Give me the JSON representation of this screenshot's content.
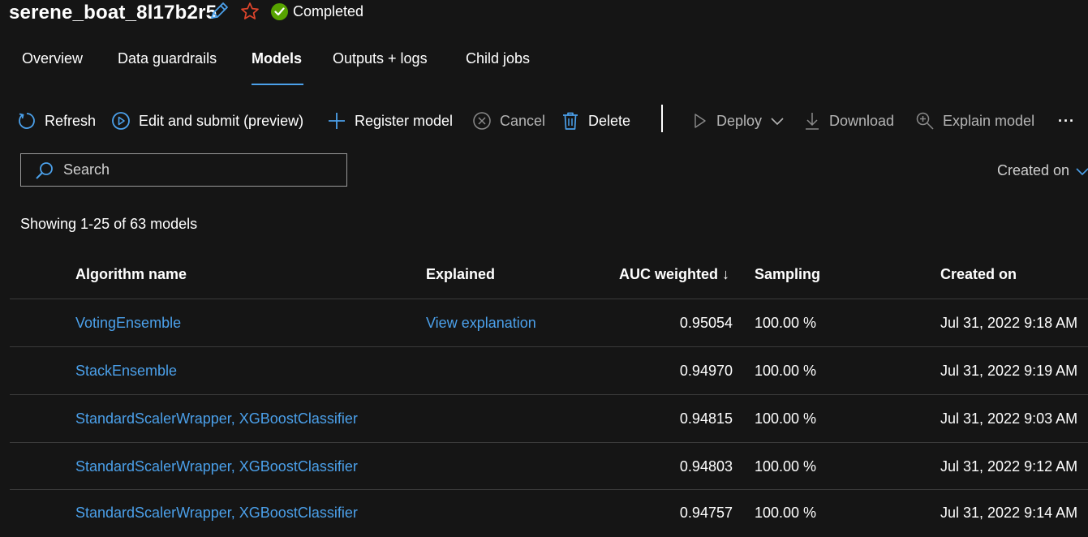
{
  "header": {
    "title": "serene_boat_8l17b2r5",
    "status": "Completed",
    "edit_icon": "pencil-icon",
    "favorite_icon": "star-icon",
    "status_icon": "check-circle-icon",
    "status_color": "#57a300"
  },
  "tabs": [
    {
      "label": "Overview"
    },
    {
      "label": "Data guardrails"
    },
    {
      "label": "Models",
      "active": true
    },
    {
      "label": "Outputs + logs"
    },
    {
      "label": "Child jobs"
    }
  ],
  "toolbar": {
    "refresh": "Refresh",
    "edit_submit": "Edit and submit (preview)",
    "register": "Register model",
    "cancel": "Cancel",
    "delete": "Delete",
    "deploy": "Deploy",
    "download": "Download",
    "explain": "Explain model",
    "more": "···"
  },
  "search": {
    "placeholder": "Search"
  },
  "sort": {
    "label": "Created on"
  },
  "summary": "Showing 1-25 of 63 models",
  "table": {
    "columns": {
      "algorithm": "Algorithm name",
      "explained": "Explained",
      "auc": "AUC weighted ↓",
      "sampling": "Sampling",
      "created": "Created on"
    },
    "rows": [
      {
        "algorithm": "VotingEnsemble",
        "explained": "View explanation",
        "auc": "0.95054",
        "sampling": "100.00 %",
        "created": "Jul 31, 2022 9:18 AM"
      },
      {
        "algorithm": "StackEnsemble",
        "explained": "",
        "auc": "0.94970",
        "sampling": "100.00 %",
        "created": "Jul 31, 2022 9:19 AM"
      },
      {
        "algorithm": "StandardScalerWrapper, XGBoostClassifier",
        "explained": "",
        "auc": "0.94815",
        "sampling": "100.00 %",
        "created": "Jul 31, 2022 9:03 AM"
      },
      {
        "algorithm": "StandardScalerWrapper, XGBoostClassifier",
        "explained": "",
        "auc": "0.94803",
        "sampling": "100.00 %",
        "created": "Jul 31, 2022 9:12 AM"
      },
      {
        "algorithm": "StandardScalerWrapper, XGBoostClassifier",
        "explained": "",
        "auc": "0.94757",
        "sampling": "100.00 %",
        "created": "Jul 31, 2022 9:14 AM"
      }
    ]
  },
  "colors": {
    "link": "#4ba0ea",
    "background": "#151515",
    "accent": "#4ba0ea"
  }
}
